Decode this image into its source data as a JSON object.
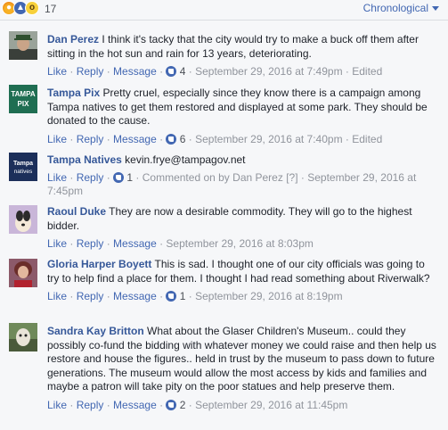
{
  "header": {
    "reaction_count": "17",
    "sort_label": "Chronological"
  },
  "actions": {
    "like": "Like",
    "reply": "Reply",
    "message": "Message"
  },
  "comments": [
    {
      "author": "Dan Perez",
      "text": "I think it's tacky that the city would try to make a buck off them after sitting in the hot sun and rain for 13 years, deteriorating.",
      "likes": "4",
      "date": "September 29, 2016 at 7:49pm",
      "edited": "Edited"
    },
    {
      "author": "Tampa Pix",
      "text": "Pretty cruel, especially since they know there is a campaign among Tampa natives to get them restored and displayed at some park. They should be donated to the cause.",
      "likes": "6",
      "date": "September 29, 2016 at 7:40pm",
      "edited": "Edited"
    },
    {
      "author": "Tampa Natives",
      "text": "kevin.frye@tampagov.net",
      "likes": "1",
      "commented_on_prefix": "Commented on by",
      "commented_on_name": "Dan Perez",
      "commented_on_suffix": "[?]",
      "date": "September 29, 2016 at 7:45pm"
    },
    {
      "author": "Raoul Duke",
      "text": "They are now a desirable commodity. They will go to the highest bidder.",
      "date": "September 29, 2016 at 8:03pm"
    },
    {
      "author": "Gloria Harper Boyett",
      "text": "This is sad. I thought one of our city officials was going to try to help find a place for them. I thought I had read something about Riverwalk?",
      "likes": "1",
      "date": "September 29, 2016 at 8:19pm"
    },
    {
      "author": "Sandra Kay Britton",
      "text": "What about the Glaser Children's Museum.. could they possibly co-fund the bidding with whatever money we could raise and then help us restore and house the figures.. held in trust by the museum to pass down to future generations. The museum would allow the most access by kids and families and maybe a patron will take pity on the poor statues and help preserve them.",
      "likes": "2",
      "date": "September 29, 2016 at 11:45pm"
    }
  ],
  "avatars": {
    "tampa_pix": "TAMPA PIX",
    "tampa_natives": "Tampa natives"
  }
}
